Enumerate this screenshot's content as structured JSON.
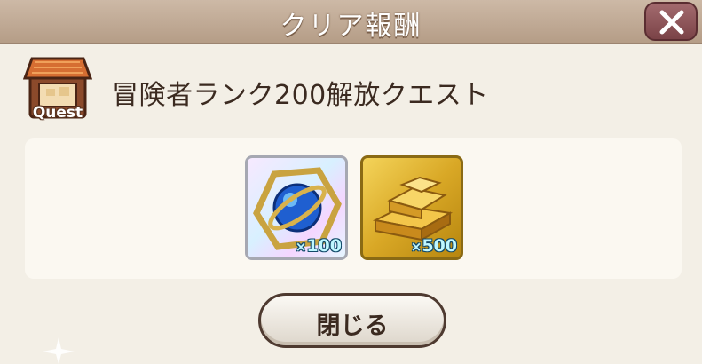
{
  "dialog": {
    "title": "クリア報酬",
    "close_icon": "x-icon"
  },
  "quest": {
    "icon": "quest-shop-icon",
    "icon_label": "Quest",
    "title": "冒険者ランク200解放クエスト"
  },
  "rewards": [
    {
      "item": "armillary-orb",
      "prefix": "×",
      "amount": "100"
    },
    {
      "item": "gold-ingots",
      "prefix": "×",
      "amount": "500"
    }
  ],
  "close_button": {
    "label": "閉じる"
  },
  "colors": {
    "header": "#b59d87",
    "panel": "#f3efe6",
    "button_border": "#4e3a30"
  }
}
